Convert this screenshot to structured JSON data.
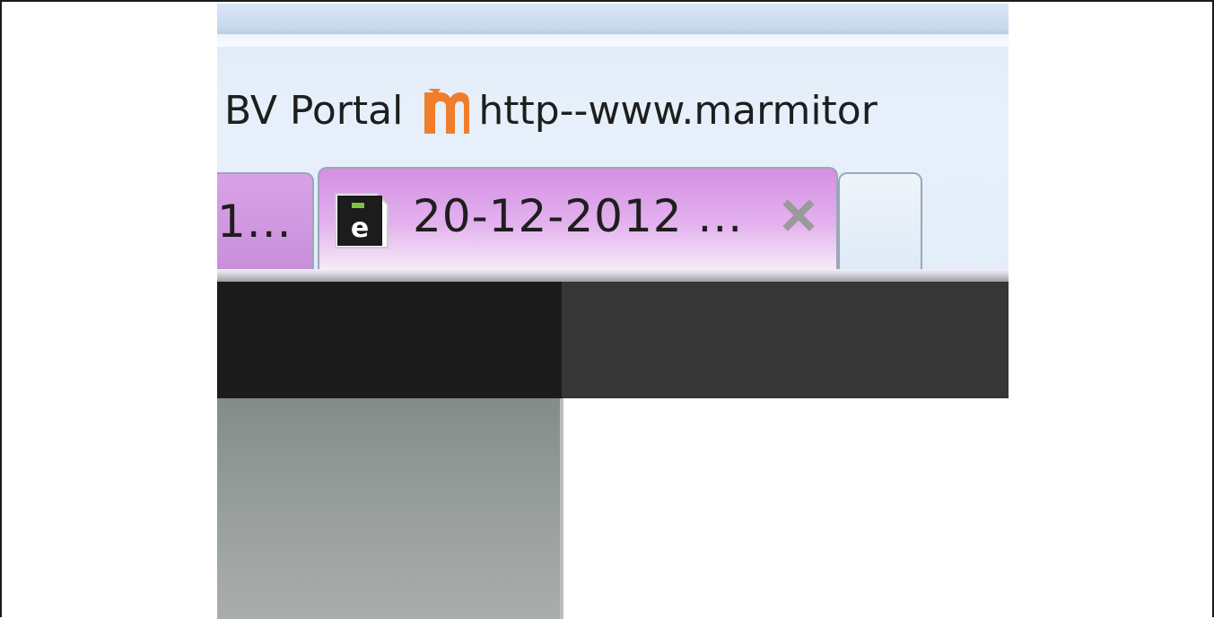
{
  "bookmarks_bar": {
    "items": [
      {
        "label": "BV Portal",
        "icon": null
      },
      {
        "label": "http--www.marmitor",
        "icon": "marmiton-m-icon"
      }
    ]
  },
  "tabs": [
    {
      "label": "1...",
      "active": false,
      "icon": null
    },
    {
      "label": "20-12-2012 ...",
      "active": true,
      "icon": "e-document-icon"
    }
  ],
  "new_tab": {
    "icon": "new-tab-icon"
  },
  "close_icon": "close-icon",
  "colors": {
    "tab_active_top": "#d58ee4",
    "tab_inactive": "#d9a2e6",
    "chrome_bg": "#e3edf9",
    "page_header_dark": "#1b1b1b",
    "page_header_gray": "#363636",
    "marmiton_orange": "#f07d2b"
  }
}
